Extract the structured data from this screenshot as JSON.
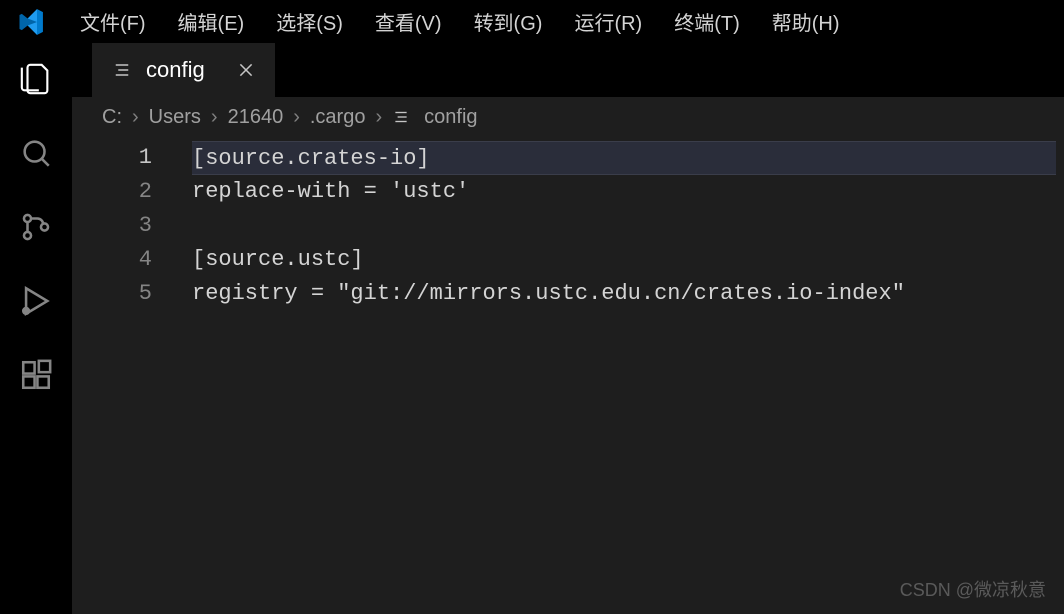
{
  "menu": {
    "file": "文件(F)",
    "edit": "编辑(E)",
    "selection": "选择(S)",
    "view": "查看(V)",
    "go": "转到(G)",
    "run": "运行(R)",
    "terminal": "终端(T)",
    "help": "帮助(H)"
  },
  "tab": {
    "label": "config"
  },
  "breadcrumbs": {
    "items": [
      "C:",
      "Users",
      "21640",
      ".cargo",
      "config"
    ]
  },
  "editor": {
    "lines": [
      {
        "num": "1",
        "text": "[source.crates-io]",
        "active": true
      },
      {
        "num": "2",
        "text": "replace-with = 'ustc'",
        "active": false
      },
      {
        "num": "3",
        "text": "",
        "active": false
      },
      {
        "num": "4",
        "text": "[source.ustc]",
        "active": false
      },
      {
        "num": "5",
        "text": "registry = \"git://mirrors.ustc.edu.cn/crates.io-index\"",
        "active": false
      }
    ]
  },
  "watermark": "CSDN @微凉秋意"
}
